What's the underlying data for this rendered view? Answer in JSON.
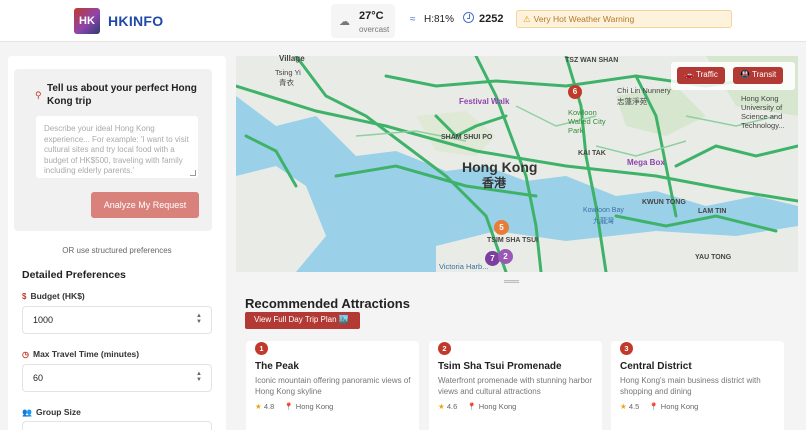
{
  "header": {
    "logo_initials": "HK",
    "logo_text": "HKINFO",
    "weather_icon": "cloud-icon",
    "temperature": "27°C",
    "condition": "overcast",
    "humidity": "H:81%",
    "time": "2252",
    "warning": "Very Hot Weather Warning"
  },
  "sidebar": {
    "ask_title": "Tell us about your perfect Hong Kong trip",
    "ask_placeholder": "Describe your ideal Hong Kong experience... For example: 'I want to visit cultural sites and try local food with a budget of HK$500, traveling with family including elderly parents.'",
    "analyze_label": "Analyze My Request",
    "or_text": "OR use structured preferences",
    "pref_title": "Detailed Preferences",
    "budget_label": "Budget (HK$)",
    "budget_value": "1000",
    "travel_label": "Max Travel Time (minutes)",
    "travel_value": "60",
    "group_label": "Group Size"
  },
  "map": {
    "traffic_label": "Traffic",
    "transit_label": "Transit",
    "labels": {
      "village": "Village",
      "tsing_yi": "Tsing Yi",
      "tsing_yi_zh": "青衣",
      "tsz_wan_shan": "TSZ WAN SHAN",
      "chi_lin": "Chi Lin Nunnery",
      "chi_lin_zh": "志蓮淨苑",
      "hkust": "Hong Kong University of Science and Technology...",
      "festival_walk": "Festival Walk",
      "kowloon_walled": "Kowloon Walled City Park",
      "sham_shui_po": "SHAM SHUI PO",
      "hong_kong": "Hong Kong",
      "hong_kong_zh": "香港",
      "kai_tak": "KAI TAK",
      "mega_box": "Mega Box",
      "kowloon_bay": "Kowloon Bay",
      "kowloon_bay_zh": "九龍灣",
      "kwun_tong": "KWUN TONG",
      "lam_tin": "LAM TIN",
      "tsim_sha_tsui": "TSIM SHA TSUI",
      "victoria": "Victoria Harb...",
      "yau_tong": "YAU TONG"
    },
    "markers": [
      "6",
      "5",
      "7",
      "2"
    ]
  },
  "attractions": {
    "title": "Recommended Attractions",
    "plan_label": "View Full Day Trip Plan 🏙️",
    "items": [
      {
        "num": "1",
        "name": "The Peak",
        "desc": "Iconic mountain offering panoramic views of Hong Kong skyline",
        "rating": "4.8",
        "location": "Hong Kong"
      },
      {
        "num": "2",
        "name": "Tsim Sha Tsui Promenade",
        "desc": "Waterfront promenade with stunning harbor views and cultural attractions",
        "rating": "4.6",
        "location": "Hong Kong"
      },
      {
        "num": "3",
        "name": "Central District",
        "desc": "Hong Kong's main business district with shopping and dining",
        "rating": "4.5",
        "location": "Hong Kong"
      }
    ]
  },
  "colors": {
    "accent": "#b33a34",
    "brand_blue": "#1f4aa8",
    "warning_bg": "#fdf3dc",
    "road_green": "#3fb26a",
    "water": "#9ad0e8",
    "land": "#e9ece6"
  }
}
